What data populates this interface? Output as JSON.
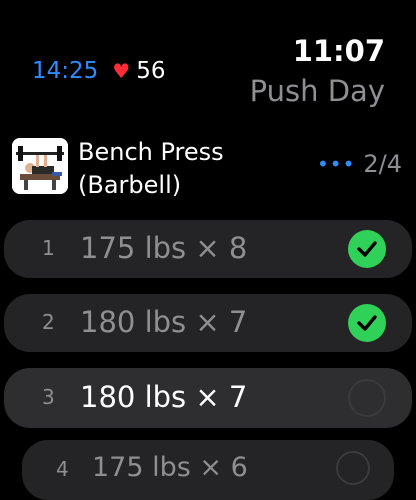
{
  "status": {
    "timer": "14:25",
    "heart_rate": "56",
    "clock": "11:07"
  },
  "workout": {
    "title": "Push Day"
  },
  "exercise": {
    "name": "Bench Press (Barbell)",
    "thumbnail_icon": "bench-press-icon",
    "more_icon": "ellipsis-icon",
    "progress": "2/4"
  },
  "sets": [
    {
      "index": "1",
      "description": "175 lbs × 8",
      "completed": true
    },
    {
      "index": "2",
      "description": "180 lbs × 7",
      "completed": true
    },
    {
      "index": "3",
      "description": "180 lbs × 7",
      "completed": false
    },
    {
      "index": "4",
      "description": "175 lbs × 6",
      "completed": false
    }
  ],
  "colors": {
    "accent": "#2f8cff",
    "heart": "#ff2d3a",
    "complete": "#30d158",
    "row_bg": "#242426",
    "muted": "#8e8e93"
  }
}
